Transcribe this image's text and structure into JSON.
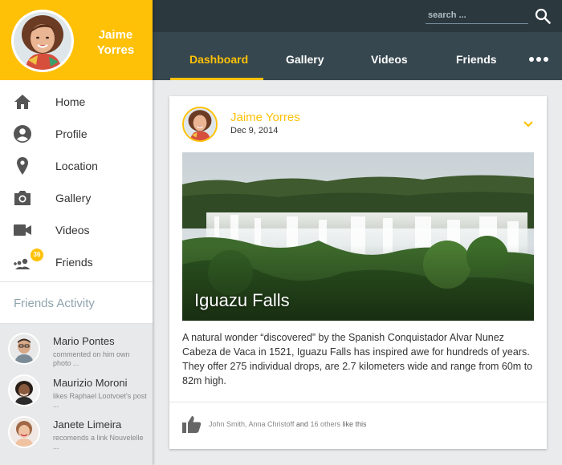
{
  "profile": {
    "name": "Jaime Yorres"
  },
  "nav": [
    {
      "label": "Home",
      "icon": "home-icon"
    },
    {
      "label": "Profile",
      "icon": "profile-icon"
    },
    {
      "label": "Location",
      "icon": "location-pin-icon"
    },
    {
      "label": "Gallery",
      "icon": "camera-icon"
    },
    {
      "label": "Videos",
      "icon": "video-camera-icon"
    },
    {
      "label": "Friends",
      "icon": "friends-icon",
      "badge": "36"
    }
  ],
  "friends_activity": {
    "title": "Friends Activity",
    "items": [
      {
        "name": "Mario Pontes",
        "desc": "commented on him own photo ..."
      },
      {
        "name": "Maurizio Moroni",
        "desc": "likes Raphael Lootvoet's post ..."
      },
      {
        "name": "Janete Limeira",
        "desc": "recomends a link Nouvelelle ..."
      }
    ]
  },
  "search": {
    "placeholder": "search ..."
  },
  "tabs": [
    {
      "label": "Dashboard",
      "active": true
    },
    {
      "label": "Gallery",
      "active": false
    },
    {
      "label": "Videos",
      "active": false
    },
    {
      "label": "Friends",
      "active": false
    }
  ],
  "post": {
    "author": "Jaime Yorres",
    "date": "Dec 9, 2014",
    "photo_title": "Iguazu Falls",
    "text": "A natural wonder “discovered” by the Spanish Conquistador Alvar Nunez Cabeza de Vaca in 1521, Iguazu Falls has inspired awe for hundreds of years. They offer 275 individual drops, are 2.7 kilometers wide and range from 60m to 82m high.",
    "likes": {
      "names": "John Smith, Anna Christoff",
      "and": "and",
      "others": "16 others",
      "suffix": "like this"
    }
  },
  "colors": {
    "accent": "#ffc107",
    "topbar": "#37474f",
    "topstrip": "#2b383e"
  }
}
